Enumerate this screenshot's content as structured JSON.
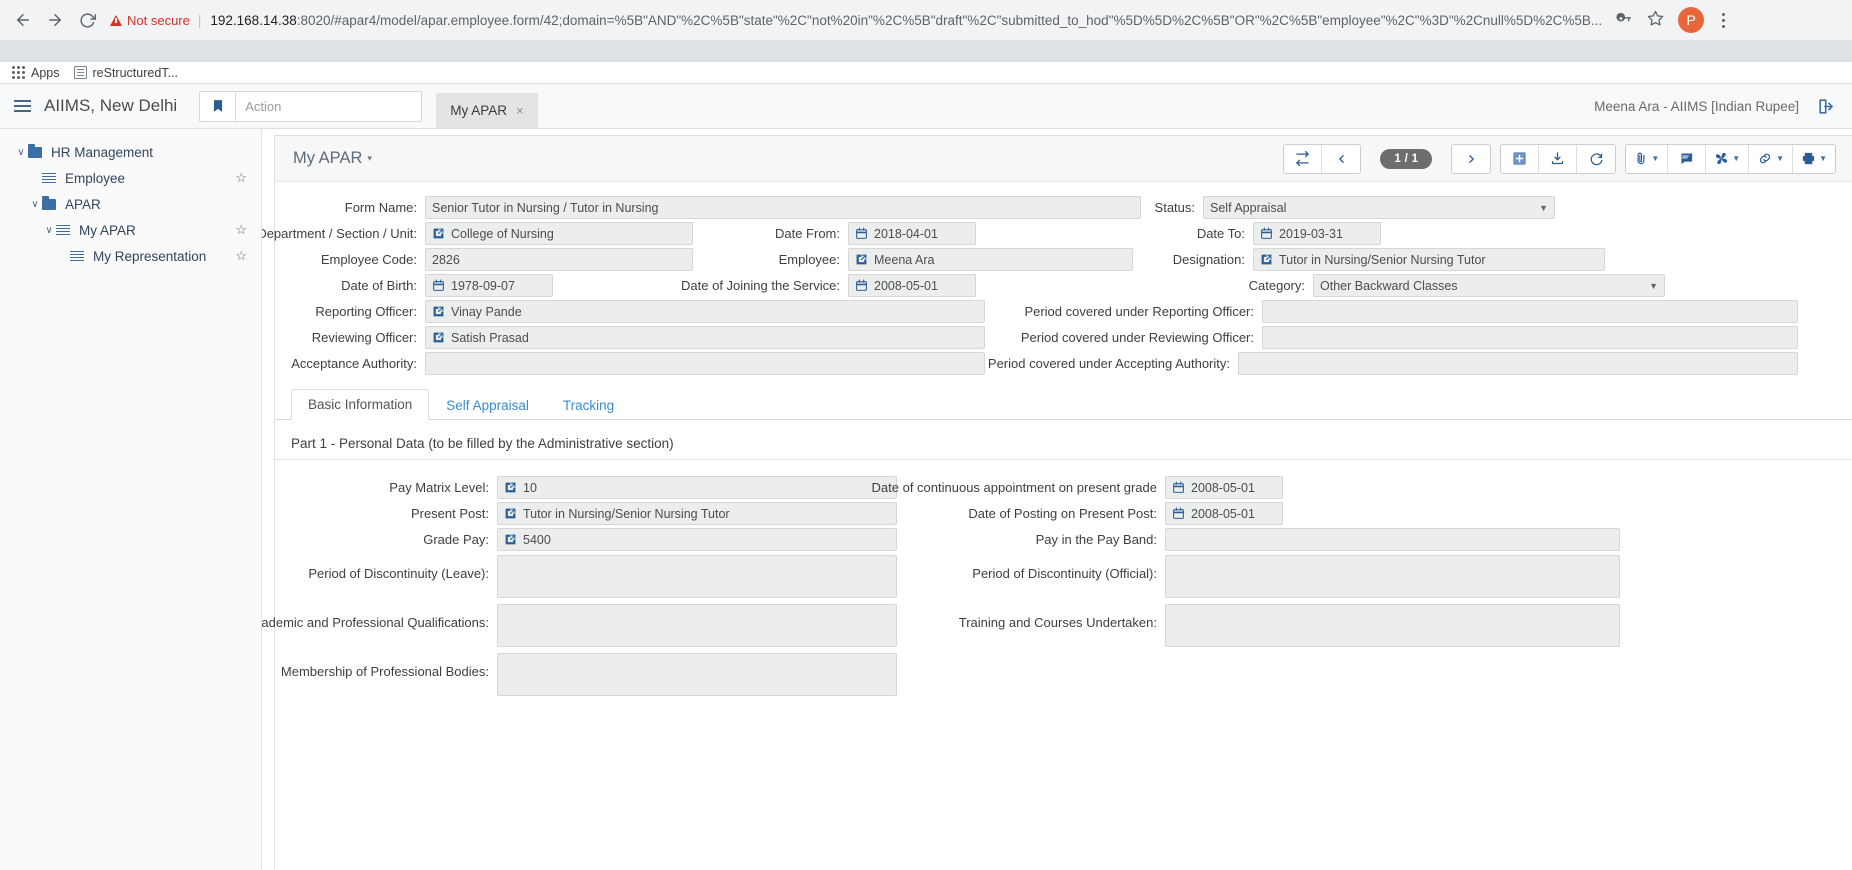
{
  "browser": {
    "security_label": "Not secure",
    "url_host": "192.168.14.38",
    "url_rest": ":8020/#apar4/model/apar.employee.form/42;domain=%5B\"AND\"%2C%5B\"state\"%2C\"not%20in\"%2C%5B\"draft\"%2C\"submitted_to_hod\"%5D%5D%2C%5B\"OR\"%2C%5B\"employee\"%2C\"%3D\"%2Cnull%5D%2C%5B...",
    "avatar_letter": "P",
    "bookmarks": [
      {
        "label": "Apps",
        "icon": "apps-grid-icon"
      },
      {
        "label": "reStructuredT...",
        "icon": "page-icon"
      }
    ]
  },
  "app_header": {
    "brand": "AIIMS, New Delhi",
    "action_placeholder": "Action",
    "action_value": "",
    "tabs": [
      {
        "label": "My APAR",
        "close": "×"
      }
    ],
    "user": "Meena Ara - AIIMS [Indian Rupee]",
    "logout_icon": "logout-icon"
  },
  "sidebar": {
    "items": [
      {
        "label": "HR Management",
        "icon": "folder-icon",
        "caret": "∨",
        "indent": 1,
        "star": false
      },
      {
        "label": "Employee",
        "icon": "list-icon",
        "caret": "",
        "indent": 2,
        "star": true
      },
      {
        "label": "APAR",
        "icon": "folder-icon",
        "caret": "∨",
        "indent": 2,
        "star": false
      },
      {
        "label": "My APAR",
        "icon": "list-icon",
        "caret": "∨",
        "indent": 3,
        "star": true
      },
      {
        "label": "My Representation",
        "icon": "list-icon",
        "caret": "",
        "indent": 4,
        "star": true
      }
    ],
    "star_glyph": "☆"
  },
  "form": {
    "title": "My APAR",
    "title_caret": "▾",
    "pager": "1 / 1",
    "toolbar_buttons": [
      {
        "name": "swap-button",
        "icon": "swap-icon"
      },
      {
        "name": "previous-record-button",
        "icon": "chevron-left-icon"
      },
      {
        "name": "next-record-button",
        "icon": "chevron-right-icon"
      },
      {
        "name": "new-record-button",
        "icon": "plus-square-icon"
      },
      {
        "name": "export-button",
        "icon": "download-icon"
      },
      {
        "name": "reload-button",
        "icon": "refresh-icon"
      },
      {
        "name": "attachment-button",
        "icon": "paperclip-icon"
      },
      {
        "name": "note-button",
        "icon": "note-icon"
      },
      {
        "name": "action-button",
        "icon": "fan-icon"
      },
      {
        "name": "link-button",
        "icon": "link-icon"
      },
      {
        "name": "print-button",
        "icon": "printer-icon"
      }
    ],
    "fields": {
      "form_name_label": "Form Name:",
      "form_name_value": "Senior Tutor in Nursing / Tutor in Nursing",
      "status_label": "Status:",
      "status_value": "Self Appraisal",
      "department_label": "Department / Section / Unit:",
      "department_value": "College of Nursing",
      "date_from_label": "Date From:",
      "date_from_value": "2018-04-01",
      "date_to_label": "Date To:",
      "date_to_value": "2019-03-31",
      "employee_code_label": "Employee Code:",
      "employee_code_value": "2826",
      "employee_label": "Employee:",
      "employee_value": "Meena Ara",
      "designation_label": "Designation:",
      "designation_value": "Tutor in Nursing/Senior Nursing Tutor",
      "dob_label": "Date of Birth:",
      "dob_value": "1978-09-07",
      "doj_label": "Date of Joining the Service:",
      "doj_value": "2008-05-01",
      "category_label": "Category:",
      "category_value": "Other Backward Classes",
      "reporting_officer_label": "Reporting Officer:",
      "reporting_officer_value": "Vinay Pande",
      "period_reporting_label": "Period covered under Reporting Officer:",
      "period_reporting_value": "",
      "reviewing_officer_label": "Reviewing Officer:",
      "reviewing_officer_value": "Satish Prasad",
      "period_reviewing_label": "Period covered under Reviewing Officer:",
      "period_reviewing_value": "",
      "acceptance_authority_label": "Acceptance Authority:",
      "acceptance_authority_value": "",
      "period_accepting_label": "Period covered under Accepting Authority:",
      "period_accepting_value": ""
    },
    "tabs": [
      {
        "label": "Basic Information",
        "active": true
      },
      {
        "label": "Self Appraisal",
        "active": false
      },
      {
        "label": "Tracking",
        "active": false
      }
    ],
    "part_title": "Part 1 - Personal Data (to be filled by the Administrative section)",
    "part1": {
      "pay_matrix_label": "Pay Matrix Level:",
      "pay_matrix_value": "10",
      "continuous_appt_label": "Date of continuous appointment on present grade",
      "continuous_appt_value": "2008-05-01",
      "present_post_label": "Present Post:",
      "present_post_value": "Tutor in Nursing/Senior Nursing Tutor",
      "date_posting_label": "Date of Posting on Present Post:",
      "date_posting_value": "2008-05-01",
      "grade_pay_label": "Grade Pay:",
      "grade_pay_value": "5400",
      "pay_in_band_label": "Pay in the Pay Band:",
      "pay_in_band_value": "",
      "discontinuity_leave_label": "Period of Discontinuity (Leave):",
      "discontinuity_leave_value": "",
      "discontinuity_official_label": "Period of Discontinuity (Official):",
      "discontinuity_official_value": "",
      "qualifications_label": "Academic and Professional Qualifications:",
      "qualifications_value": "",
      "training_label": "Training and Courses Undertaken:",
      "training_value": "",
      "membership_label": "Membership of Professional Bodies:",
      "membership_value": ""
    }
  },
  "colors": {
    "accent": "#3a6ea5",
    "danger": "#d93025",
    "field_bg": "#eceded",
    "tab_link": "#3a8ad1"
  }
}
